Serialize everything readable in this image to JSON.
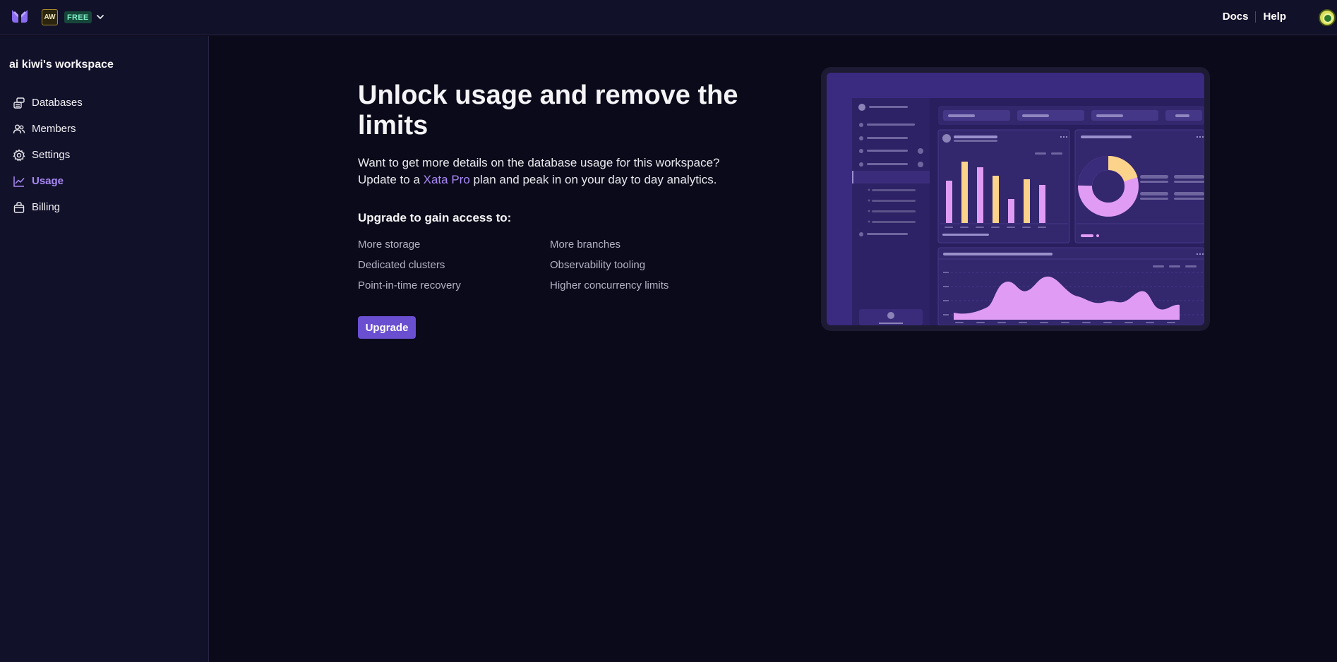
{
  "topbar": {
    "workspace_initials": "AW",
    "plan_badge": "FREE",
    "links": {
      "docs": "Docs",
      "help": "Help"
    }
  },
  "sidebar": {
    "workspace_title": "ai kiwi's workspace",
    "items": [
      {
        "label": "Databases",
        "icon": "database-icon"
      },
      {
        "label": "Members",
        "icon": "members-icon"
      },
      {
        "label": "Settings",
        "icon": "gear-icon"
      },
      {
        "label": "Usage",
        "icon": "chart-line-icon",
        "active": true
      },
      {
        "label": "Billing",
        "icon": "bag-icon"
      }
    ]
  },
  "main": {
    "title": "Unlock usage and remove the limits",
    "description_line1": "Want to get more details on the database usage for this workspace?",
    "description_pre": "Update to a ",
    "description_link": "Xata Pro",
    "description_post": " plan and peak in on your day to day analytics.",
    "access_title": "Upgrade to gain access to:",
    "features": [
      "More storage",
      "More branches",
      "Dedicated clusters",
      "Observability tooling",
      "Point-in-time recovery",
      "Higher concurrency limits"
    ],
    "upgrade_label": "Upgrade"
  },
  "colors": {
    "background": "#0b0a1a",
    "panel": "#12112a",
    "accent": "#a98af7",
    "button": "#6a4fd1",
    "preview_bg": "#3a2a80",
    "preview_pink": "#e09cf4",
    "preview_yellow": "#fcd38a"
  }
}
